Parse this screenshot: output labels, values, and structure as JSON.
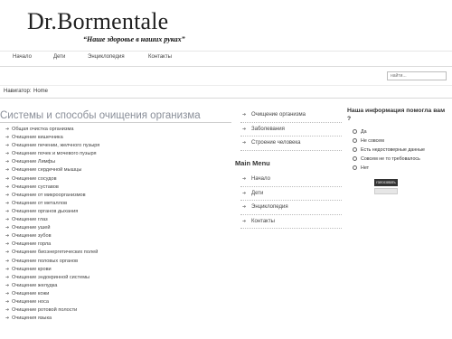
{
  "header": {
    "logo_prefix": "Dr.",
    "logo_name": "Bormentale",
    "tagline": "“Наше здоровье в наших руках”"
  },
  "topnav": [
    {
      "label": "Начало"
    },
    {
      "label": "Дети"
    },
    {
      "label": "Энциклопедия"
    },
    {
      "label": "Контакты"
    }
  ],
  "search": {
    "placeholder": "найти..."
  },
  "breadcrumb": {
    "label": "Навигатор:",
    "current": "Home"
  },
  "content": {
    "title": "Системы и способы очищения организма",
    "items": [
      "Общая очистка организма",
      "Очищение кишечника",
      "Очищение печении, желчного пузыря",
      "Очищение почек и мочевого пузыря",
      "Очищение Лимфы",
      "Очищение сердечной мышцы",
      "Очищение сосудов",
      "Очищение суставов",
      "Очищение от микроорганизмов",
      "Очищение от металлов",
      "Очищение органов дыхания",
      "Очищение глаз",
      "Очищение ушей",
      "Очищение зубов",
      "Очищение горла",
      "Очищение биоэнергетических полей",
      "Очищение половых органов",
      "Очищение крови",
      "Очищение эндокринной системы",
      "Очищение желудка",
      "Очищение кожи",
      "Очищение носа",
      "Очищение ротовой полости",
      "Очищения языка"
    ]
  },
  "side_menu": [
    {
      "label": "Очищение организма"
    },
    {
      "label": "Заболевания"
    },
    {
      "label": "Строение человека"
    }
  ],
  "main_menu": {
    "title": "Main Menu",
    "items": [
      {
        "label": "Начало"
      },
      {
        "label": "Дети"
      },
      {
        "label": "Энциклопедия"
      },
      {
        "label": "Контакты"
      }
    ]
  },
  "poll": {
    "title": "Наша информация помогла вам ?",
    "options": [
      {
        "label": "Да"
      },
      {
        "label": "Не совсем"
      },
      {
        "label": "Есть недостоверные данные"
      },
      {
        "label": "Совсем не то требовалось"
      },
      {
        "label": "Нет"
      }
    ],
    "vote_label": "голосовать"
  }
}
